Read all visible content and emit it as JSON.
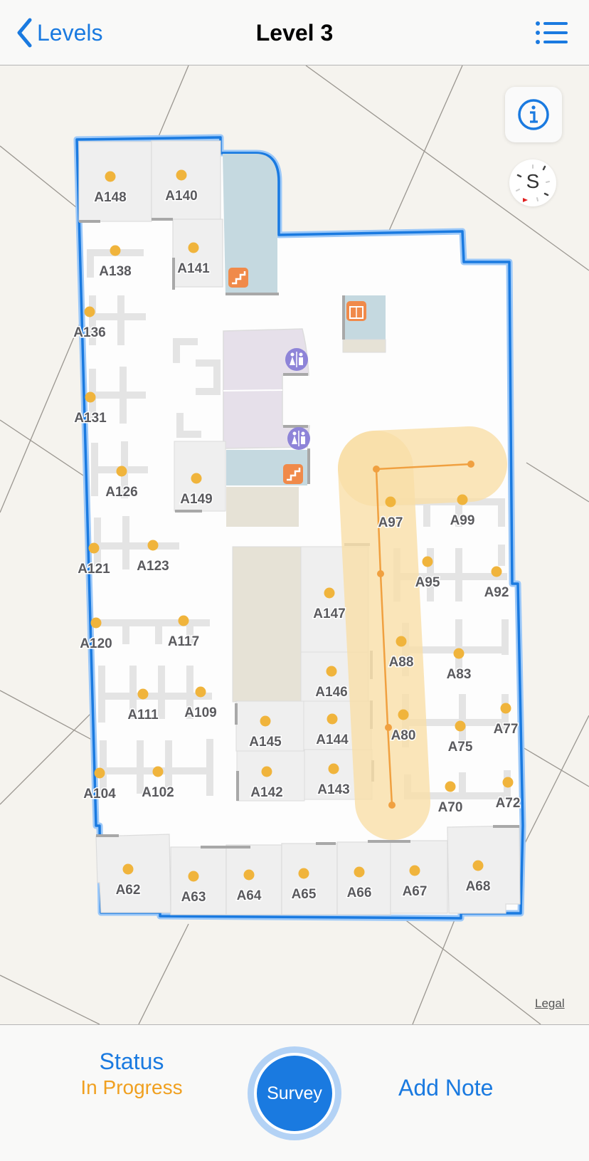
{
  "nav": {
    "back_label": "Levels",
    "title": "Level 3",
    "back_icon": "chevron-left-icon",
    "menu_icon": "list-icon"
  },
  "map": {
    "info_icon": "info-icon",
    "compass_heading": "S",
    "legal_label": "Legal",
    "accent_color": "#1a7ae0",
    "route_color": "#f0a040",
    "dot_color": "#f0b43c",
    "rooms": [
      {
        "id": "A148"
      },
      {
        "id": "A140"
      },
      {
        "id": "A141"
      },
      {
        "id": "A138"
      },
      {
        "id": "A136"
      },
      {
        "id": "A131"
      },
      {
        "id": "A126"
      },
      {
        "id": "A149"
      },
      {
        "id": "A121"
      },
      {
        "id": "A123"
      },
      {
        "id": "A120"
      },
      {
        "id": "A117"
      },
      {
        "id": "A111"
      },
      {
        "id": "A109"
      },
      {
        "id": "A104"
      },
      {
        "id": "A102"
      },
      {
        "id": "A147"
      },
      {
        "id": "A146"
      },
      {
        "id": "A145"
      },
      {
        "id": "A144"
      },
      {
        "id": "A142"
      },
      {
        "id": "A143"
      },
      {
        "id": "A97"
      },
      {
        "id": "A99"
      },
      {
        "id": "A95"
      },
      {
        "id": "A92"
      },
      {
        "id": "A88"
      },
      {
        "id": "A83"
      },
      {
        "id": "A80"
      },
      {
        "id": "A75"
      },
      {
        "id": "A77"
      },
      {
        "id": "A70"
      },
      {
        "id": "A72"
      },
      {
        "id": "A62"
      },
      {
        "id": "A63"
      },
      {
        "id": "A64"
      },
      {
        "id": "A65"
      },
      {
        "id": "A66"
      },
      {
        "id": "A67"
      },
      {
        "id": "A68"
      }
    ],
    "amenities": [
      "stairs-icon",
      "elevator-icon",
      "restroom-icon",
      "restroom-icon",
      "stairs-icon"
    ]
  },
  "toolbar": {
    "status_label": "Status",
    "status_value": "In Progress",
    "survey_label": "Survey",
    "add_note_label": "Add Note"
  }
}
